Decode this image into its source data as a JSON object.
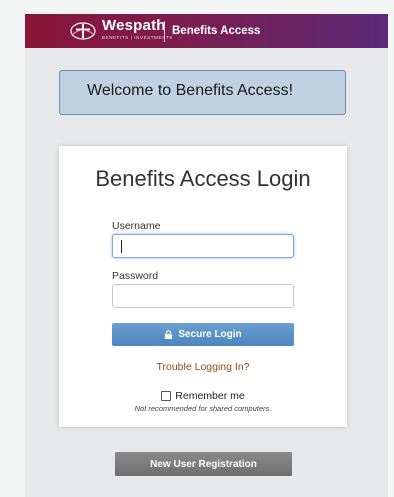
{
  "header": {
    "brand": "Wespath",
    "brand_sub": "BENEFITS | INVESTMENTS",
    "app_name": "Benefits Access"
  },
  "welcome": {
    "text": "Welcome to Benefits Access!"
  },
  "login": {
    "title": "Benefits Access Login",
    "username_label": "Username",
    "username_value": "",
    "password_label": "Password",
    "password_value": "",
    "submit_label": "Secure Login",
    "submit_icon": "lock-icon",
    "trouble_link": "Trouble Logging In?",
    "remember_label": "Remember me",
    "remember_checked": false,
    "remember_note": "Not recommended for shared computers."
  },
  "registration": {
    "button_label": "New User Registration"
  },
  "colors": {
    "header_start": "#8a1538",
    "header_end": "#5b2a78",
    "welcome_bg": "#c0d2e1",
    "login_button": "#5a93c8",
    "link": "#9a4a12",
    "registration_button": "#7a7a7a"
  }
}
